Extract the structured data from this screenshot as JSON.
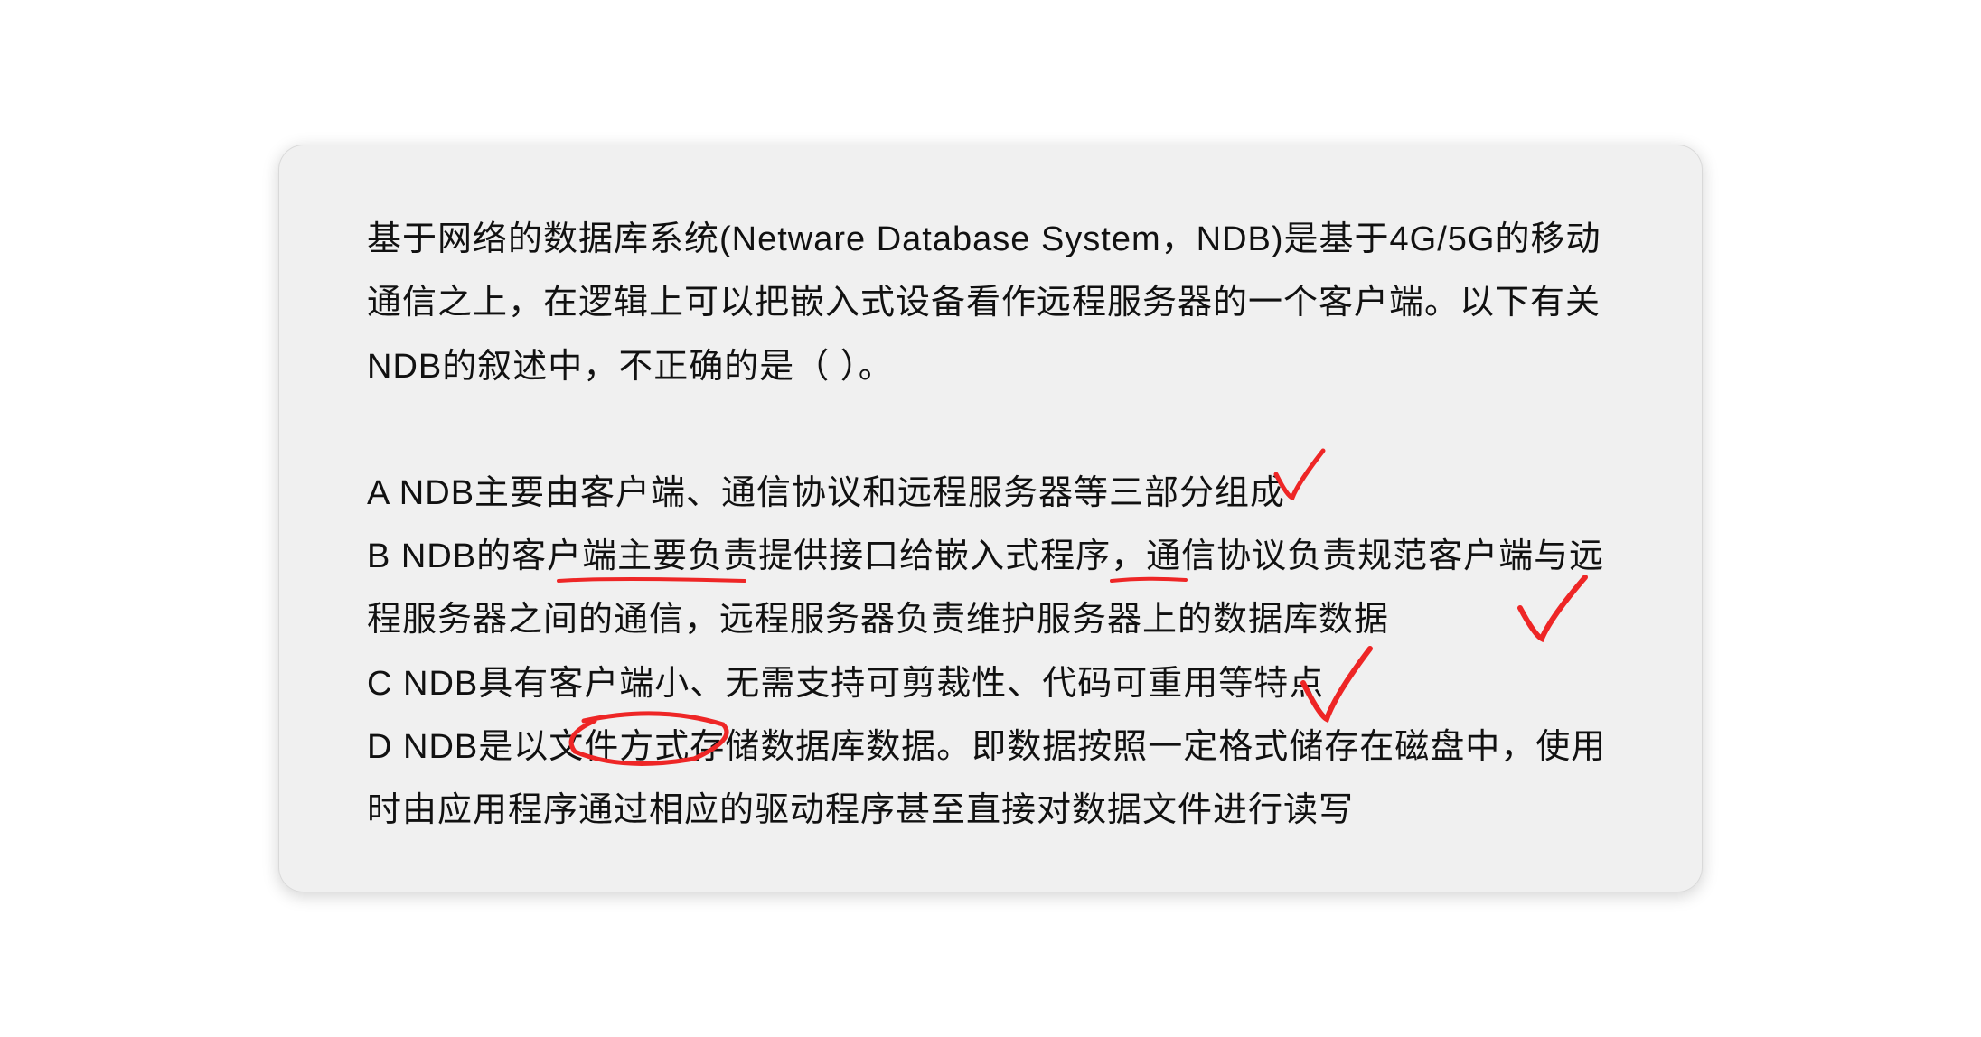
{
  "question": {
    "stem": "基于网络的数据库系统(Netware Database System，NDB)是基于4G/5G的移动通信之上，在逻辑上可以把嵌入式设备看作远程服务器的一个客户端。以下有关NDB的叙述中，不正确的是（ ）。",
    "options": {
      "A": "A NDB主要由客户端、通信协议和远程服务器等三部分组成",
      "B": "B NDB的客户端主要负责提供接口给嵌入式程序，通信协议负责规范客户端与远程服务器之间的通信，远程服务器负责维护服务器上的数据库数据",
      "C": "C NDB具有客户端小、无需支持可剪裁性、代码可重用等特点",
      "D": "D NDB是以文件方式存储数据库数据。即数据按照一定格式储存在磁盘中，使用时由应用程序通过相应的驱动程序甚至直接对数据文件进行读写"
    }
  },
  "annotations": {
    "stroke": "#ee2626",
    "check_A": true,
    "check_B": true,
    "check_C": true,
    "underline_B1": true,
    "underline_B2": true,
    "circle_D": true
  }
}
